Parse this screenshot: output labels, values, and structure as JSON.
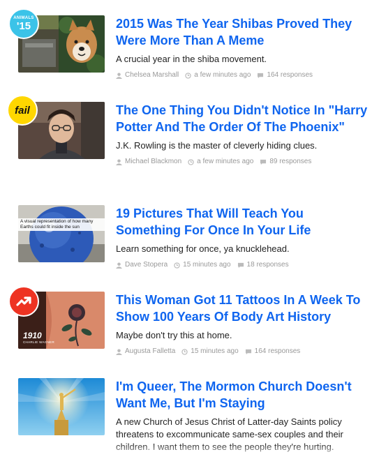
{
  "articles": [
    {
      "title": "2015 Was The Year Shibas Proved They Were More Than A Meme",
      "description": "A crucial year in the shiba movement.",
      "author": "Chelsea Marshall",
      "time": "a few minutes ago",
      "responses": "164 responses",
      "badge": {
        "type": "circle-text",
        "line1": "ANIMALS",
        "line2": "'15",
        "color": "#3bc3e8"
      },
      "thumb_icon": "shiba-dog-photo-icon"
    },
    {
      "title": "The One Thing You Didn't Notice In \"Harry Potter And The Order Of The Phoenix\"",
      "description": "J.K. Rowling is the master of cleverly hiding clues.",
      "author": "Michael Blackmon",
      "time": "a few minutes ago",
      "responses": "89 responses",
      "badge": {
        "type": "fail",
        "label": "fail",
        "color": "#ffd700"
      },
      "thumb_icon": "harry-potter-photo-icon"
    },
    {
      "title": "19 Pictures That Will Teach You Something For Once In Your Life",
      "description": "Learn something for once, ya knucklehead.",
      "author": "Dave Stopera",
      "time": "15 minutes ago",
      "responses": "18 responses",
      "thumb_caption": "A visual representation of how many Earths could fit inside the sun",
      "thumb_icon": "earths-sphere-photo-icon"
    },
    {
      "title": "This Woman Got 11 Tattoos In A Week To Show 100 Years Of Body Art History",
      "description": "Maybe don't try this at home.",
      "author": "Augusta Falletta",
      "time": "15 minutes ago",
      "responses": "164 responses",
      "badge": {
        "type": "trending",
        "color": "#ee3322"
      },
      "thumb_caption": "1910",
      "thumb_subcaption": "CHARLIE WAGNER",
      "thumb_icon": "rose-tattoo-photo-icon"
    },
    {
      "title": "I'm Queer, The Mormon Church Doesn't Want Me, But I'm Staying",
      "description": "A new Church of Jesus Christ of Latter-day Saints policy threatens to excommunicate same-sex couples and their children. I want them to see the people they're hurting.",
      "thumb_icon": "angel-moroni-statue-photo-icon"
    }
  ]
}
